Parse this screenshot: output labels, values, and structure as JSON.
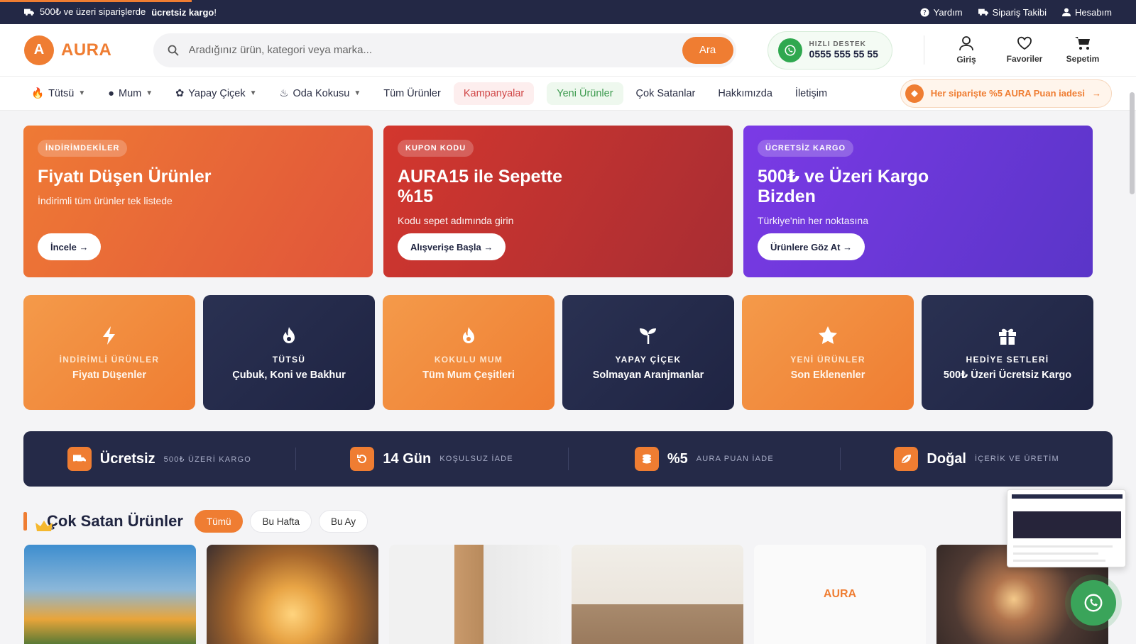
{
  "topbar": {
    "shipping_prefix": "500₺ ve üzeri siparişlerde",
    "shipping_bold": "ücretsiz kargo",
    "shipping_suffix": "!",
    "help": "Yardım",
    "tracking": "Sipariş Takibi",
    "account": "Hesabım"
  },
  "header": {
    "logo_letter": "A",
    "logo_text": "AURA",
    "search_placeholder": "Aradığınız ürün, kategori veya marka...",
    "search_button": "Ara",
    "support_label": "HIZLI DESTEK",
    "support_number": "0555 555 55 55",
    "actions": [
      {
        "label": "Giriş",
        "icon": "user-icon"
      },
      {
        "label": "Favoriler",
        "icon": "heart-icon"
      },
      {
        "label": "Sepetim",
        "icon": "cart-icon"
      }
    ]
  },
  "nav": {
    "items": [
      "Tütsü",
      "Mum",
      "Yapay Çiçek",
      "Oda Kokusu",
      "Tüm Ürünler",
      "Kampanyalar",
      "Yeni Ürünler",
      "Çok Satanlar",
      "Hakkımızda",
      "İletişim"
    ],
    "points_text": "Her siparişte %5 AURA Puan iadesi"
  },
  "promos": [
    {
      "badge": "İNDİRİMDEKİLER",
      "title": "Fiyatı Düşen Ürünler",
      "desc": "İndirimli tüm ürünler tek listede",
      "button": "İncele"
    },
    {
      "badge": "KUPON KODU",
      "title": "AURA15 ile Sepette %15",
      "desc": "Kodu sepet adımında girin",
      "button": "Alışverişe Başla"
    },
    {
      "badge": "ÜCRETSİZ KARGO",
      "title": "500₺ ve Üzeri Kargo Bizden",
      "desc": "Türkiye'nin her noktasına",
      "button": "Ürünlere Göz At"
    }
  ],
  "categories": [
    {
      "title": "İNDİRİMLİ ÜRÜNLER",
      "subtitle": "Fiyatı Düşenler",
      "icon": "lightning-icon"
    },
    {
      "title": "TÜTSÜ",
      "subtitle": "Çubuk, Koni ve Bakhur",
      "icon": "flame-icon"
    },
    {
      "title": "KOKULU MUM",
      "subtitle": "Tüm Mum Çeşitleri",
      "icon": "flame-icon"
    },
    {
      "title": "YAPAY ÇİÇEK",
      "subtitle": "Solmayan Aranjmanlar",
      "icon": "sprout-icon"
    },
    {
      "title": "YENİ ÜRÜNLER",
      "subtitle": "Son Eklenenler",
      "icon": "star-icon"
    },
    {
      "title": "HEDİYE SETLERİ",
      "subtitle": "500₺ Üzeri Ücretsiz Kargo",
      "icon": "gift-icon"
    }
  ],
  "features": [
    {
      "big": "Ücretsiz",
      "small": "500₺ ÜZERİ KARGO",
      "icon": "truck-icon"
    },
    {
      "big": "14 Gün",
      "small": "KOŞULSUZ İADE",
      "icon": "return-icon"
    },
    {
      "big": "%5",
      "small": "AURA PUAN İADE",
      "icon": "coins-icon"
    },
    {
      "big": "Doğal",
      "small": "İÇERİK VE ÜRETİM",
      "icon": "leaf-icon"
    }
  ],
  "bestsellers": {
    "title": "Çok Satan Ürünler",
    "tabs": [
      "Tümü",
      "Bu Hafta",
      "Bu Ay"
    ],
    "placeholder_logo": "AURA"
  },
  "colors": {
    "accent": "#ef7d32",
    "navy": "#252a48",
    "green": "#3aa45a"
  }
}
